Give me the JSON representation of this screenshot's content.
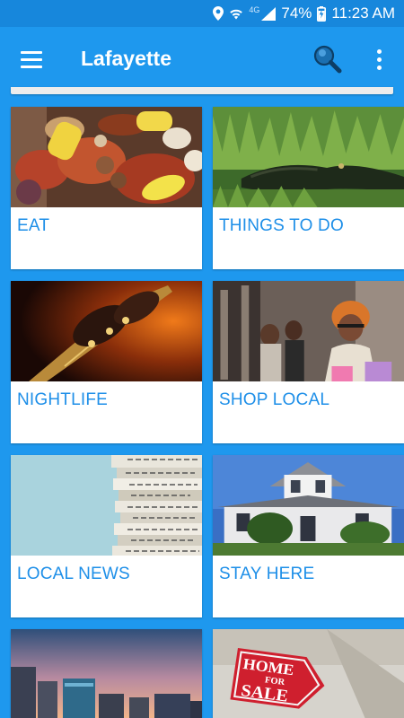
{
  "status_bar": {
    "network": "4G",
    "battery": "74%",
    "time": "11:23 AM"
  },
  "app_bar": {
    "title": "Lafayette"
  },
  "cards": [
    {
      "label": "EAT"
    },
    {
      "label": "THINGS TO DO"
    },
    {
      "label": "NIGHTLIFE"
    },
    {
      "label": "SHOP LOCAL"
    },
    {
      "label": "LOCAL NEWS"
    },
    {
      "label": "STAY HERE"
    },
    {
      "label": ""
    },
    {
      "label": ""
    }
  ],
  "sign_text": {
    "line1": "HOME",
    "line2": "FOR",
    "line3": "SALE"
  },
  "colors": {
    "primary": "#1E98EE",
    "status_bar": "#1787DC",
    "card_label": "#1E8FE8",
    "card_bg": "#FFFFFF"
  }
}
